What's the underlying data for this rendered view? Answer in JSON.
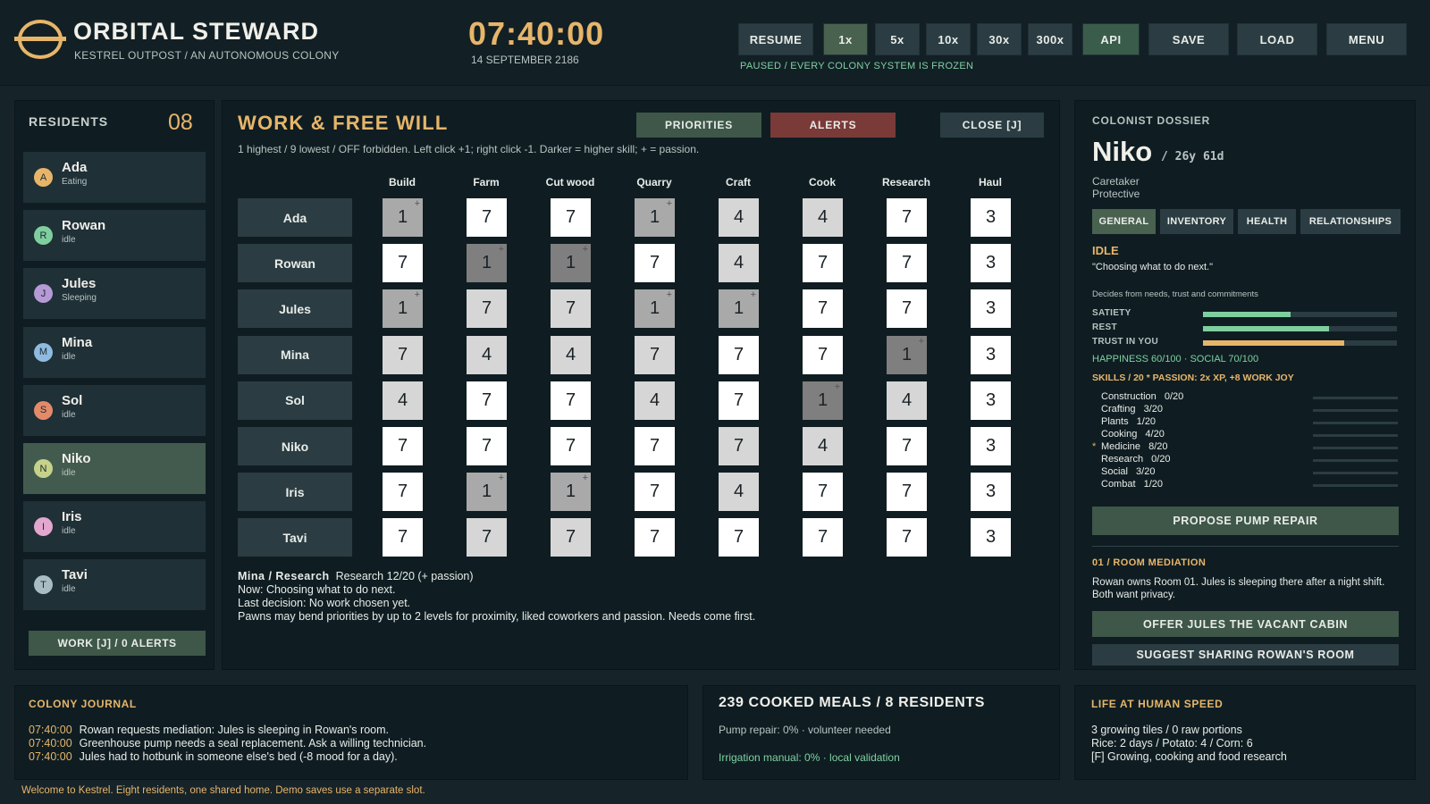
{
  "app": {
    "title": "ORBITAL STEWARD",
    "subtitle": "KESTREL OUTPOST  /  AN AUTONOMOUS COLONY"
  },
  "time": {
    "clock": "07:40:00",
    "date": "14 SEPTEMBER 2186"
  },
  "controls": {
    "buttons": [
      {
        "label": "RESUME",
        "active": false
      },
      {
        "label": "1x",
        "active": true
      },
      {
        "label": "5x",
        "active": false
      },
      {
        "label": "10x",
        "active": false
      },
      {
        "label": "30x",
        "active": false
      },
      {
        "label": "300x",
        "active": false
      },
      {
        "label": "API",
        "active": false
      },
      {
        "label": "SAVE",
        "active": false
      },
      {
        "label": "LOAD",
        "active": false
      },
      {
        "label": "MENU",
        "active": false
      }
    ],
    "status": "PAUSED  /  EVERY COLONY SYSTEM IS FROZEN"
  },
  "residents": {
    "title": "RESIDENTS",
    "count": "08",
    "items": [
      {
        "initial": "A",
        "name": "Ada",
        "status": "Eating",
        "color": "#e7b56a"
      },
      {
        "initial": "R",
        "name": "Rowan",
        "status": "idle",
        "color": "#7fcf9e"
      },
      {
        "initial": "J",
        "name": "Jules",
        "status": "Sleeping",
        "color": "#b59ad6"
      },
      {
        "initial": "M",
        "name": "Mina",
        "status": "idle",
        "color": "#8fbbe0"
      },
      {
        "initial": "S",
        "name": "Sol",
        "status": "idle",
        "color": "#e48a6a"
      },
      {
        "initial": "N",
        "name": "Niko",
        "status": "idle",
        "color": "#c6d28a"
      },
      {
        "initial": "I",
        "name": "Iris",
        "status": "idle",
        "color": "#e2a6cf"
      },
      {
        "initial": "T",
        "name": "Tavi",
        "status": "idle",
        "color": "#a9bcc3"
      }
    ],
    "selected": "Niko",
    "work_button": "WORK [J]  /  0 ALERTS"
  },
  "work": {
    "title": "WORK & FREE WILL",
    "tabs": {
      "priorities": "PRIORITIES",
      "alerts": "ALERTS",
      "close": "CLOSE [J]"
    },
    "help": "1 highest / 9 lowest / OFF forbidden. Left click +1; right click -1. Darker = higher skill; + = passion.",
    "columns": [
      "Build",
      "Farm",
      "Cut wood",
      "Quarry",
      "Craft",
      "Cook",
      "Research",
      "Haul"
    ],
    "rows": [
      {
        "name": "Ada",
        "cells": [
          {
            "v": "1",
            "s": 2,
            "p": true
          },
          {
            "v": "7",
            "s": 0
          },
          {
            "v": "7",
            "s": 0
          },
          {
            "v": "1",
            "s": 2,
            "p": true
          },
          {
            "v": "4",
            "s": 1
          },
          {
            "v": "4",
            "s": 1
          },
          {
            "v": "7",
            "s": 0
          },
          {
            "v": "3",
            "s": 0
          }
        ]
      },
      {
        "name": "Rowan",
        "cells": [
          {
            "v": "7",
            "s": 0
          },
          {
            "v": "1",
            "s": 3,
            "p": true
          },
          {
            "v": "1",
            "s": 3,
            "p": true
          },
          {
            "v": "7",
            "s": 0
          },
          {
            "v": "4",
            "s": 1
          },
          {
            "v": "7",
            "s": 0
          },
          {
            "v": "7",
            "s": 0
          },
          {
            "v": "3",
            "s": 0
          }
        ]
      },
      {
        "name": "Jules",
        "cells": [
          {
            "v": "1",
            "s": 2,
            "p": true
          },
          {
            "v": "7",
            "s": 1
          },
          {
            "v": "7",
            "s": 1
          },
          {
            "v": "1",
            "s": 2,
            "p": true
          },
          {
            "v": "1",
            "s": 2,
            "p": true
          },
          {
            "v": "7",
            "s": 0
          },
          {
            "v": "7",
            "s": 0
          },
          {
            "v": "3",
            "s": 0
          }
        ]
      },
      {
        "name": "Mina",
        "cells": [
          {
            "v": "7",
            "s": 1
          },
          {
            "v": "4",
            "s": 1
          },
          {
            "v": "4",
            "s": 1
          },
          {
            "v": "7",
            "s": 1
          },
          {
            "v": "7",
            "s": 0
          },
          {
            "v": "7",
            "s": 0
          },
          {
            "v": "1",
            "s": 3,
            "p": true
          },
          {
            "v": "3",
            "s": 0
          }
        ]
      },
      {
        "name": "Sol",
        "cells": [
          {
            "v": "4",
            "s": 1
          },
          {
            "v": "7",
            "s": 0
          },
          {
            "v": "7",
            "s": 0
          },
          {
            "v": "4",
            "s": 1
          },
          {
            "v": "7",
            "s": 0
          },
          {
            "v": "1",
            "s": 3,
            "p": true
          },
          {
            "v": "4",
            "s": 1
          },
          {
            "v": "3",
            "s": 0
          }
        ]
      },
      {
        "name": "Niko",
        "cells": [
          {
            "v": "7",
            "s": 0
          },
          {
            "v": "7",
            "s": 0
          },
          {
            "v": "7",
            "s": 0
          },
          {
            "v": "7",
            "s": 0
          },
          {
            "v": "7",
            "s": 1
          },
          {
            "v": "4",
            "s": 1
          },
          {
            "v": "7",
            "s": 0
          },
          {
            "v": "3",
            "s": 0
          }
        ]
      },
      {
        "name": "Iris",
        "cells": [
          {
            "v": "7",
            "s": 0
          },
          {
            "v": "1",
            "s": 2,
            "p": true
          },
          {
            "v": "1",
            "s": 2,
            "p": true
          },
          {
            "v": "7",
            "s": 0
          },
          {
            "v": "4",
            "s": 1
          },
          {
            "v": "7",
            "s": 0
          },
          {
            "v": "7",
            "s": 0
          },
          {
            "v": "3",
            "s": 0
          }
        ]
      },
      {
        "name": "Tavi",
        "cells": [
          {
            "v": "7",
            "s": 0
          },
          {
            "v": "7",
            "s": 1
          },
          {
            "v": "7",
            "s": 1
          },
          {
            "v": "7",
            "s": 0
          },
          {
            "v": "7",
            "s": 0
          },
          {
            "v": "7",
            "s": 0
          },
          {
            "v": "7",
            "s": 0
          },
          {
            "v": "3",
            "s": 0
          }
        ]
      }
    ],
    "detail": {
      "heading": "Mina / Research",
      "skill": "Research 12/20 (+ passion)",
      "now": "Now: Choosing what to do next.",
      "last": "Last decision: No work chosen yet.",
      "note": "Pawns may bend priorities by up to 2 levels for proximity, liked coworkers and passion. Needs come first."
    }
  },
  "dossier": {
    "heading": "COLONIST DOSSIER",
    "name": "Niko",
    "age": "/ 26y 61d",
    "traits": [
      "Caretaker",
      "Protective"
    ],
    "tabs": [
      "GENERAL",
      "INVENTORY",
      "HEALTH",
      "RELATIONSHIPS"
    ],
    "state": "IDLE",
    "quote": "\"Choosing what to do next.\"",
    "note": "Decides from needs, trust and commitments",
    "needs": [
      {
        "label": "SATIETY",
        "value": 0.45,
        "color": "#7fcf9e"
      },
      {
        "label": "REST",
        "value": 0.65,
        "color": "#7fcf9e"
      },
      {
        "label": "TRUST IN YOU",
        "value": 0.73,
        "color": "#e7b56a"
      }
    ],
    "happiness": "HAPPINESS 60/100   ·   SOCIAL 70/100",
    "skills_heading": "SKILLS / 20     * PASSION: 2x XP, +8 WORK JOY",
    "skills": [
      {
        "name": "Construction",
        "value": "0/20",
        "passion": false
      },
      {
        "name": "Crafting",
        "value": "3/20",
        "passion": false
      },
      {
        "name": "Plants",
        "value": "1/20",
        "passion": false
      },
      {
        "name": "Cooking",
        "value": "4/20",
        "passion": false
      },
      {
        "name": "Medicine",
        "value": "8/20",
        "passion": true
      },
      {
        "name": "Research",
        "value": "0/20",
        "passion": false
      },
      {
        "name": "Social",
        "value": "3/20",
        "passion": false
      },
      {
        "name": "Combat",
        "value": "1/20",
        "passion": false
      }
    ],
    "propose_button": "PROPOSE PUMP REPAIR",
    "mediation_heading": "01 / ROOM MEDIATION",
    "mediation_text": "Rowan owns Room 01. Jules is sleeping there after a night shift. Both want privacy.",
    "offer_button": "OFFER JULES THE VACANT CABIN",
    "suggest_button": "SUGGEST SHARING ROWAN'S ROOM"
  },
  "journal": {
    "heading": "COLONY JOURNAL",
    "entries": [
      {
        "time": "07:40:00",
        "text": "Rowan requests mediation: Jules is sleeping in Rowan's room."
      },
      {
        "time": "07:40:00",
        "text": "Greenhouse pump needs a seal replacement. Ask a willing technician."
      },
      {
        "time": "07:40:00",
        "text": "Jules had to hotbunk in someone else's bed (-8 mood for a day)."
      }
    ]
  },
  "meals": {
    "heading": "239 COOKED MEALS   /   8 RESIDENTS",
    "pump": "Pump repair: 0% · volunteer needed",
    "irrigation": "Irrigation manual: 0% · local validation"
  },
  "life": {
    "heading": "LIFE AT HUMAN SPEED",
    "lines": [
      "3 growing tiles / 0 raw portions",
      "Rice: 2 days / Potato: 4 / Corn: 6",
      "[F] Growing, cooking and food research"
    ]
  },
  "footer": "Welcome to Kestrel. Eight residents, one shared home. Demo saves use a separate slot.",
  "colors": {
    "accent": "#e7b56a",
    "green": "#7fcf9e",
    "panel": "#0f1d22",
    "alert": "#7a3a38"
  }
}
